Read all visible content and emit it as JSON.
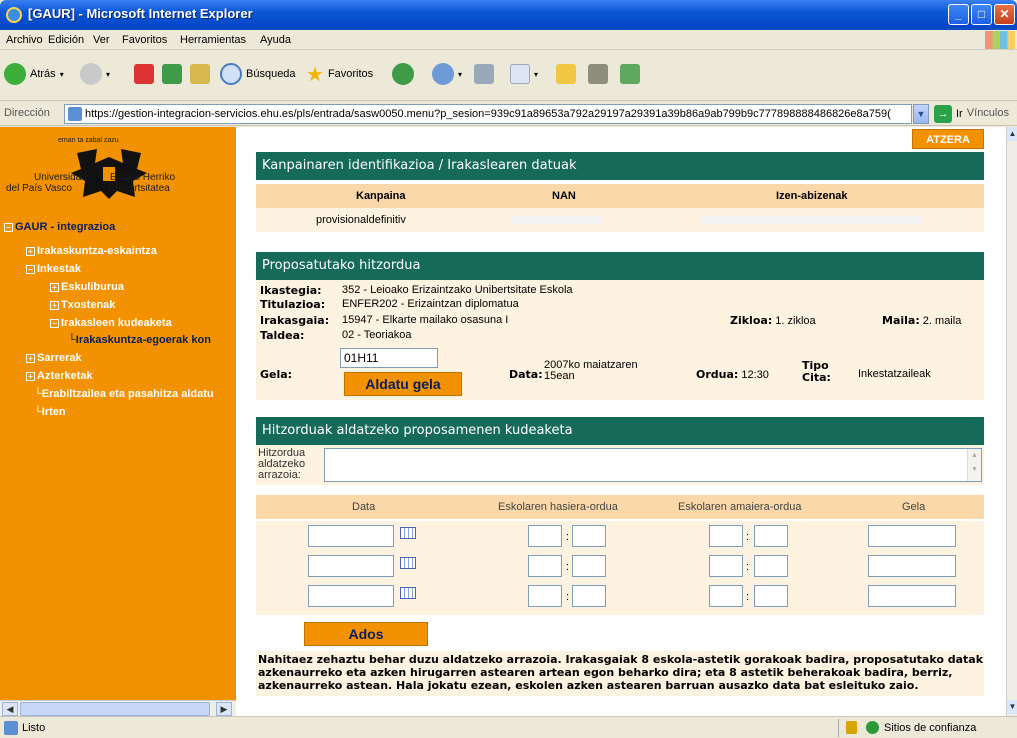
{
  "window": {
    "title": "[GAUR] - Microsoft Internet Explorer"
  },
  "menu": [
    "Archivo",
    "Edición",
    "Ver",
    "Favoritos",
    "Herramientas",
    "Ayuda"
  ],
  "toolbar": {
    "back": "Atrás",
    "search": "Búsqueda",
    "favorites": "Favoritos"
  },
  "address": {
    "label": "Dirección",
    "url": "https://gestion-integracion-servicios.ehu.es/pls/entrada/sasw0050.menu?p_sesion=939c91a89653a792a29197a29391a39b86a9ab799b9c777898888486826e8a759(",
    "go": "Ir",
    "links": "Vínculos"
  },
  "sidebar": {
    "logo_caption": "eman ta zabal zazu",
    "uni_es": "Universidad",
    "uni_es2": "del País Vasco",
    "uni_eu": "Euskal Herriko",
    "uni_eu2": "Unibertsitatea",
    "items": [
      "GAUR - integrazioa",
      "Irakaskuntza-eskaintza",
      "Inkestak",
      "Eskuliburua",
      "Txostenak",
      "Irakasleen kudeaketa",
      "Irakaskuntza-egoerak kon",
      "Sarrerak",
      "Azterketak",
      "Erabiltzailea eta pasahitza aldatu",
      "Irten"
    ]
  },
  "back_button": "ATZERA",
  "section1": {
    "title": "Kanpainaren identifikazioa / Irakaslearen datuak",
    "col_kanpaina": "Kanpaina",
    "col_nan": "NAN",
    "col_izen": "Izen-abizenak",
    "kanpaina_value": "provisionaldefinitiv"
  },
  "section2": {
    "title": "Proposatutako hitzordua",
    "ikastegia_label": "Ikastegia:",
    "ikastegia": "352 - Leioako Erizaintzako Unibertsitate Eskola",
    "titulazioa_label": "Titulazioa:",
    "titulazioa": "ENFER202 - Erizaintzan diplomatua",
    "irakasgaia_label": "Irakasgaia:",
    "irakasgaia": "15947 - Elkarte mailako osasuna I",
    "taldea_label": "Taldea:",
    "taldea": "02 - Teoriakoa",
    "zikloa_label": "Zikloa:",
    "zikloa": "1. zikloa",
    "maila_label": "Maila:",
    "maila": "2. maila",
    "gela_label": "Gela:",
    "gela_value": "01H11",
    "aldatu_button": "Aldatu gela",
    "data_label": "Data:",
    "data_line1": "2007ko maiatzaren",
    "data_line2": "15ean",
    "ordua_label": "Ordua:",
    "ordua": "12:30",
    "tipo_label1": "Tipo",
    "tipo_label2": "Cita:",
    "tipo": "Inkestatzaileak"
  },
  "section3": {
    "title": "Hitzorduak aldatzeko proposamenen kudeaketa",
    "reason_label": "Hitzordua aldatzeko arrazoia:",
    "col_data": "Data",
    "col_hasiera": "Eskolaren hasiera-ordua",
    "col_amaiera": "Eskolaren amaiera-ordua",
    "col_gela": "Gela",
    "colon": ":",
    "ados_button": "Ados"
  },
  "note": "Nahitaez zehaztu behar duzu aldatzeko arrazoia. Irakasgaiak 8 eskola-astetik gorakoak badira, proposatutako datak azkenaurreko eta azken hirugarren astearen artean egon beharko dira; eta 8 astetik beherakoak badira, berriz, azkenaurreko astean. Hala jokatu ezean, eskolen azken astearen barruan ausazko data bat esleituko zaio.",
  "status": {
    "text": "Listo",
    "zone": "Sitios de confianza"
  }
}
